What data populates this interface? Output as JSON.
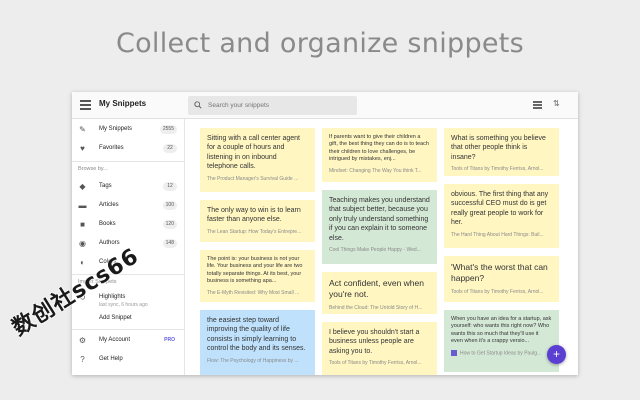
{
  "headline": "Collect and organize snippets",
  "app": {
    "title": "My Snippets",
    "search_placeholder": "Search your snippets"
  },
  "sidebar": {
    "top_items": [
      {
        "label": "My Snippets",
        "count": "2555",
        "icon": "pen-icon"
      },
      {
        "label": "Favorites",
        "count": "22",
        "icon": "heart-icon"
      }
    ],
    "browse_heading": "Browse by...",
    "browse_items": [
      {
        "label": "Tags",
        "count": "12",
        "icon": "tag-icon"
      },
      {
        "label": "Articles",
        "count": "100",
        "icon": "article-icon"
      },
      {
        "label": "Books",
        "count": "120",
        "icon": "book-icon"
      },
      {
        "label": "Authors",
        "count": "148",
        "icon": "author-icon"
      },
      {
        "label": "Colors",
        "count": "",
        "icon": "palette-icon"
      }
    ],
    "import_heading": "Import Snippets",
    "import_item": {
      "label": "Highlights",
      "sub": "last sync, 6 hours ago",
      "icon": "sync-icon"
    },
    "add_snippet": "Add Snippet",
    "account": {
      "label": "My Account",
      "badge": "PRO",
      "icon": "gear-icon"
    },
    "help": {
      "label": "Get Help",
      "icon": "help-icon"
    }
  },
  "columns": [
    [
      {
        "text": "Sitting with a call center agent for a couple of hours and listening in on inbound telephone calls.",
        "source": "The Product Manager's Survival Guide ...",
        "color": "yellow"
      },
      {
        "text": "The only way to win is to learn faster than anyone else.",
        "source": "The Lean Startup: How Today's Entrepre...",
        "color": "yellow"
      },
      {
        "text": "The point is: your business is not your life. Your business and your life are two totally separate things. At its best, your business is something apa...",
        "source": "The E-Myth Revisited: Why Most Small ...",
        "color": "yellow"
      },
      {
        "text": "the easiest step toward improving the quality of life consists in simply learning to control the body and its senses.",
        "source": "Flow: The Psychology of Happiness by ...",
        "color": "blue"
      }
    ],
    [
      {
        "text": "If parents want to give their children a gift, the best thing they can do is to teach their children to love challenges, be intrigued by mistakes, enj...",
        "source": "Mindset: Changing The Way You think T...",
        "color": "yellow"
      },
      {
        "text": "Teaching makes you understand that subject better, because you only truly understand something if you can explain it to someone else.",
        "source": "Cool Things Make People Happy - Wed...",
        "color": "green"
      },
      {
        "text": "Act confident, even when you're not.",
        "source": "Behind the Cloud: The Untold Story of H...",
        "color": "yellow"
      },
      {
        "text": "I believe you shouldn't start a business unless people are asking you to.",
        "source": "Tools of Titans by Timothy Ferriss, Arnol...",
        "color": "yellow"
      }
    ],
    [
      {
        "text": "What is something you believe that other people think is insane?",
        "source": "Tools of Titans by Timothy Ferriss, Arnol...",
        "color": "yellow"
      },
      {
        "text": "obvious. The first thing that any successful CEO must do is get really great people to work for her.",
        "source": "The Hard Thing About Hard Things: Buil...",
        "color": "yellow"
      },
      {
        "text": "'What's the worst that can happen?",
        "source": "Tools of Titans by Timothy Ferriss, Arnol...",
        "color": "yellow"
      },
      {
        "text": "When you have an idea for a startup, ask yourself: who wants this right now? Who wants this so much that they'll use it even when it's a crappy versio...",
        "source": "How to Get Startup Ideas by Paulg...",
        "color": "green"
      }
    ]
  ],
  "watermark": "数创社scs66",
  "colors": {
    "accent": "#5b3fd3",
    "yellow": "#fff6c2",
    "green": "#d4e8d6",
    "blue": "#bfe1fb"
  }
}
